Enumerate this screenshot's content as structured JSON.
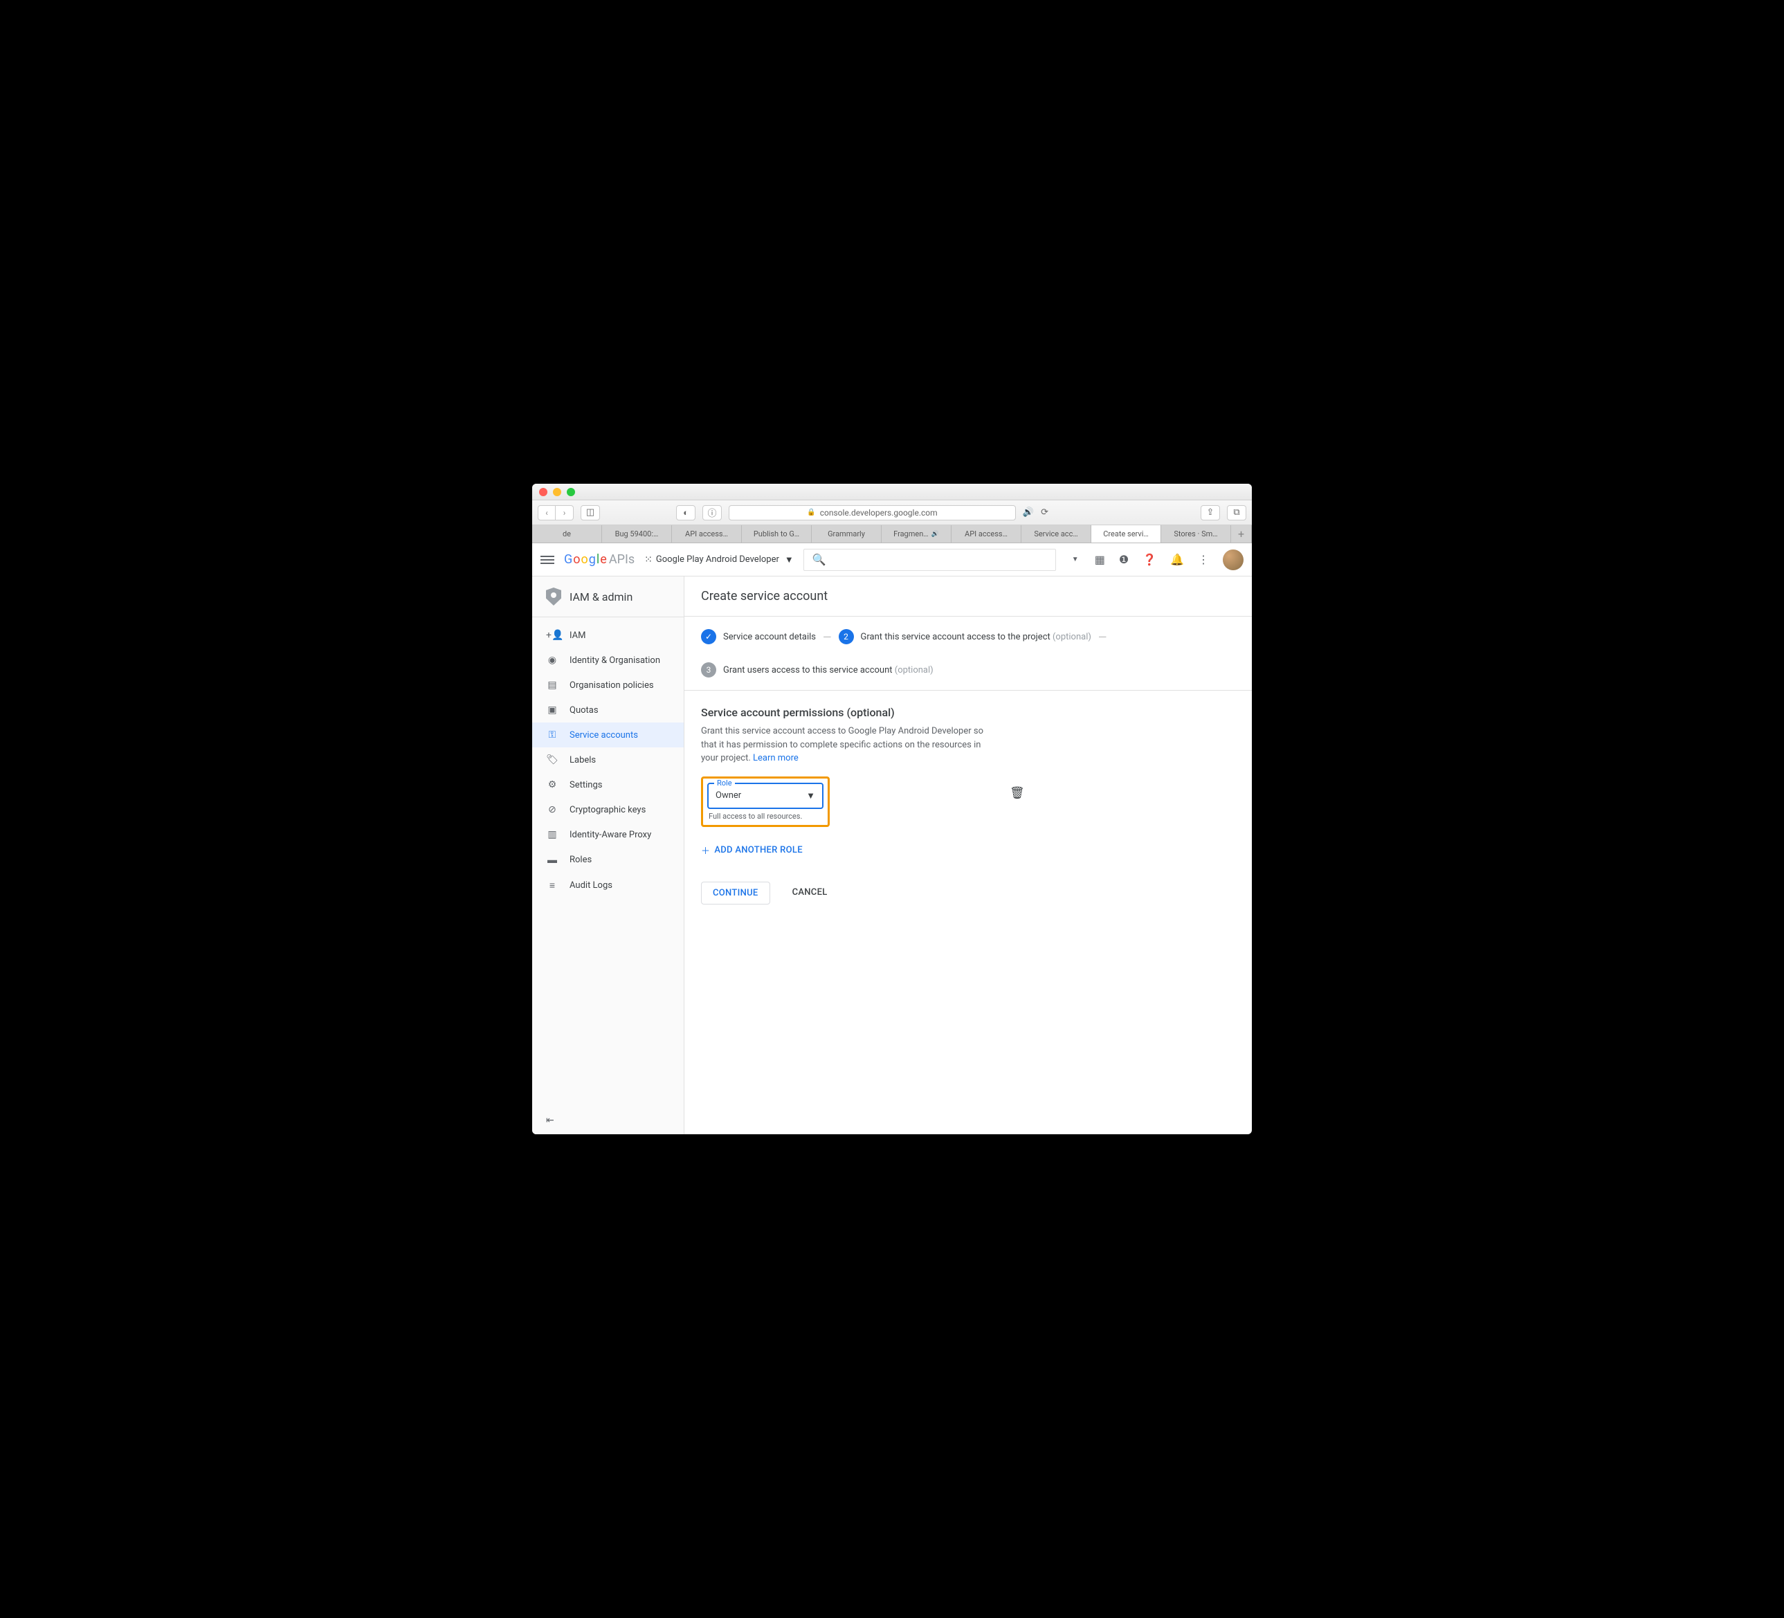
{
  "browser": {
    "url": "console.developers.google.com",
    "tabs": [
      "de",
      "Bug 59400:…",
      "API access…",
      "Publish to G…",
      "Grammarly",
      "Fragmen…",
      "API access…",
      "Service acc…",
      "Create servi…",
      "Stores · Sm…"
    ],
    "activeTabIndex": 8,
    "soundTabs": [
      5
    ]
  },
  "header": {
    "logo_apis": "APIs",
    "project": "Google Play Android Developer"
  },
  "sidebar": {
    "section": "IAM & admin",
    "items": [
      {
        "icon": "👤",
        "label": "IAM"
      },
      {
        "icon": "◉",
        "label": "Identity & Organisation"
      },
      {
        "icon": "▦",
        "label": "Organisation policies"
      },
      {
        "icon": "▣",
        "label": "Quotas"
      },
      {
        "icon": "�սୀ",
        "label": "Service accounts"
      },
      {
        "icon": "🏷",
        "label": "Labels"
      },
      {
        "icon": "⚙",
        "label": "Settings"
      },
      {
        "icon": "⊘",
        "label": "Cryptographic keys"
      },
      {
        "icon": "▤",
        "label": "Identity-Aware Proxy"
      },
      {
        "icon": "▬",
        "label": "Roles"
      },
      {
        "icon": "≡",
        "label": "Audit Logs"
      }
    ],
    "activeIndex": 4
  },
  "page": {
    "title": "Create service account",
    "steps": {
      "s1": "Service account details",
      "s2": "Grant this service account access to the project",
      "s2_opt": "(optional)",
      "s3": "Grant users access to this service account",
      "s3_opt": "(optional)",
      "n2": "2",
      "n3": "3"
    },
    "perms": {
      "heading": "Service account permissions (optional)",
      "desc": "Grant this service account access to Google Play Android Developer so that it has permission to complete specific actions on the resources in your project. ",
      "learn": "Learn more",
      "role_label": "Role",
      "role_value": "Owner",
      "role_hint": "Full access to all resources.",
      "add_role": "ADD ANOTHER ROLE",
      "continue": "CONTINUE",
      "cancel": "CANCEL"
    }
  }
}
